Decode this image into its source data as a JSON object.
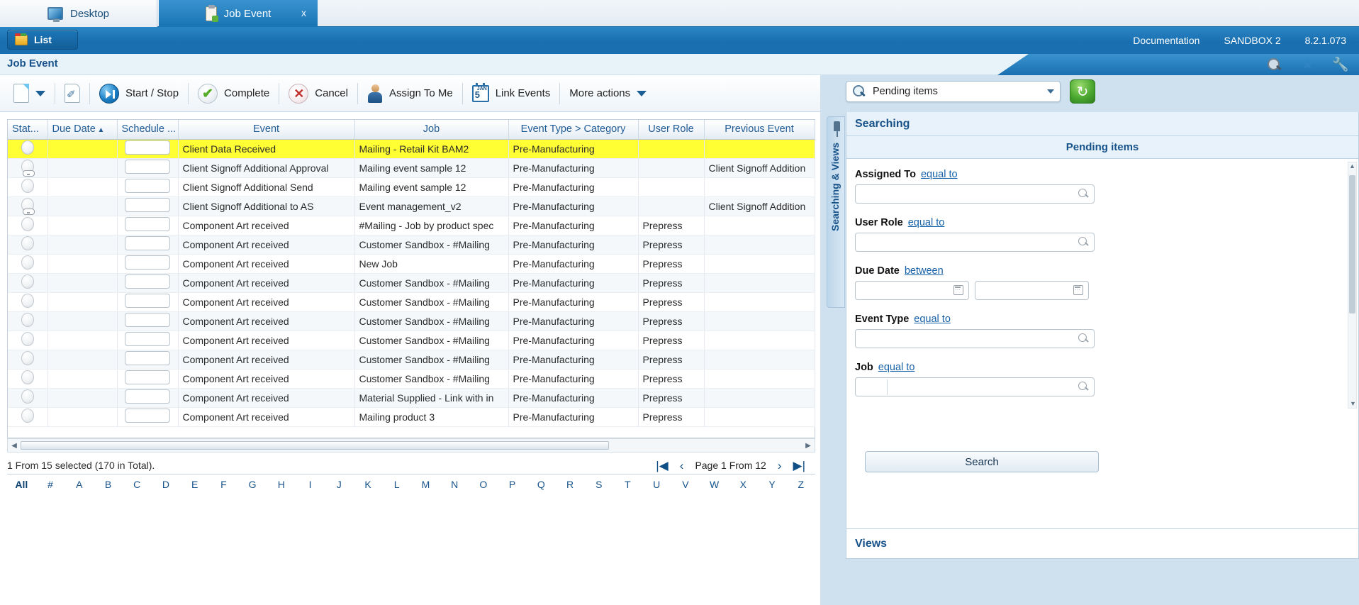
{
  "tabs": [
    {
      "label": "Desktop",
      "icon": "monitor-icon",
      "active": false
    },
    {
      "label": "Job Event",
      "icon": "clipboard-icon",
      "active": true,
      "close": "x"
    }
  ],
  "header": {
    "list_button": "List",
    "documentation": "Documentation",
    "environment": "SANDBOX 2",
    "version": "8.2.1.073"
  },
  "page": {
    "title": "Job Event"
  },
  "toolbar": {
    "new_label": "",
    "edit_label": "",
    "start_stop": "Start / Stop",
    "complete": "Complete",
    "cancel": "Cancel",
    "assign_to_me": "Assign To Me",
    "link_events": "Link Events",
    "more_actions": "More actions"
  },
  "grid": {
    "columns": [
      {
        "label": "Stat...",
        "sort": ""
      },
      {
        "label": "Due Date",
        "sort": "▲"
      },
      {
        "label": "Schedule ...",
        "sort": ""
      },
      {
        "label": "Event",
        "sort": ""
      },
      {
        "label": "Job",
        "sort": ""
      },
      {
        "label": "Event Type > Category",
        "sort": ""
      },
      {
        "label": "User Role",
        "sort": ""
      },
      {
        "label": "Previous Event",
        "sort": ""
      }
    ],
    "rows": [
      {
        "status": "pending",
        "due": "",
        "schedule": "",
        "event": "Client Data Received",
        "job": "Mailing - Retail Kit BAM2",
        "type": "Pre-Manufacturing",
        "role": "",
        "prev": "",
        "selected": true
      },
      {
        "status": "linked",
        "due": "",
        "schedule": "",
        "event": "Client Signoff Additional Approval",
        "job": "Mailing event sample 12",
        "type": "Pre-Manufacturing",
        "role": "",
        "prev": "Client Signoff Addition"
      },
      {
        "status": "pending",
        "due": "",
        "schedule": "",
        "event": "Client Signoff Additional Send",
        "job": "Mailing event sample 12",
        "type": "Pre-Manufacturing",
        "role": "",
        "prev": ""
      },
      {
        "status": "linked",
        "due": "",
        "schedule": "",
        "event": "Client Signoff Additional to AS",
        "job": "Event management_v2",
        "type": "Pre-Manufacturing",
        "role": "",
        "prev": "Client Signoff Addition"
      },
      {
        "status": "pending",
        "due": "",
        "schedule": "",
        "event": "Component Art received",
        "job": "#Mailing - Job by product spec",
        "type": "Pre-Manufacturing",
        "role": "Prepress",
        "prev": ""
      },
      {
        "status": "pending",
        "due": "",
        "schedule": "",
        "event": "Component Art received",
        "job": "Customer Sandbox - #Mailing",
        "type": "Pre-Manufacturing",
        "role": "Prepress",
        "prev": ""
      },
      {
        "status": "pending",
        "due": "",
        "schedule": "",
        "event": "Component Art received",
        "job": "New Job",
        "type": "Pre-Manufacturing",
        "role": "Prepress",
        "prev": ""
      },
      {
        "status": "pending",
        "due": "",
        "schedule": "",
        "event": "Component Art received",
        "job": "Customer Sandbox - #Mailing",
        "type": "Pre-Manufacturing",
        "role": "Prepress",
        "prev": ""
      },
      {
        "status": "pending",
        "due": "",
        "schedule": "",
        "event": "Component Art received",
        "job": "Customer Sandbox - #Mailing",
        "type": "Pre-Manufacturing",
        "role": "Prepress",
        "prev": ""
      },
      {
        "status": "pending",
        "due": "",
        "schedule": "",
        "event": "Component Art received",
        "job": "Customer Sandbox - #Mailing",
        "type": "Pre-Manufacturing",
        "role": "Prepress",
        "prev": ""
      },
      {
        "status": "pending",
        "due": "",
        "schedule": "",
        "event": "Component Art received",
        "job": "Customer Sandbox - #Mailing",
        "type": "Pre-Manufacturing",
        "role": "Prepress",
        "prev": ""
      },
      {
        "status": "pending",
        "due": "",
        "schedule": "",
        "event": "Component Art received",
        "job": "Customer Sandbox - #Mailing",
        "type": "Pre-Manufacturing",
        "role": "Prepress",
        "prev": ""
      },
      {
        "status": "pending",
        "due": "",
        "schedule": "",
        "event": "Component Art received",
        "job": "Customer Sandbox - #Mailing",
        "type": "Pre-Manufacturing",
        "role": "Prepress",
        "prev": ""
      },
      {
        "status": "pending",
        "due": "",
        "schedule": "",
        "event": "Component Art received",
        "job": "Material Supplied - Link with in",
        "type": "Pre-Manufacturing",
        "role": "Prepress",
        "prev": ""
      },
      {
        "status": "pending",
        "due": "",
        "schedule": "",
        "event": "Component Art received",
        "job": "Mailing product 3",
        "type": "Pre-Manufacturing",
        "role": "Prepress",
        "prev": ""
      }
    ]
  },
  "status": {
    "summary": "1 From 15 selected (170 in Total).",
    "page_text": "Page 1 From 12",
    "first": "|◀",
    "prev": "‹",
    "next": "›",
    "last": "▶|"
  },
  "alphabet": [
    "All",
    "#",
    "A",
    "B",
    "C",
    "D",
    "E",
    "F",
    "G",
    "H",
    "I",
    "J",
    "K",
    "L",
    "M",
    "N",
    "O",
    "P",
    "Q",
    "R",
    "S",
    "T",
    "U",
    "V",
    "W",
    "X",
    "Y",
    "Z"
  ],
  "sidebar": {
    "vertical_tab": "Searching & Views",
    "search_select": "Pending items",
    "panel_title": "Searching",
    "panel_subtitle": "Pending items",
    "fields": [
      {
        "label": "Assigned To",
        "operator": "equal to",
        "kind": "lookup",
        "value": ""
      },
      {
        "label": "User Role",
        "operator": "equal to",
        "kind": "lookup",
        "value": ""
      },
      {
        "label": "Due Date",
        "operator": "between",
        "kind": "daterange",
        "value": "",
        "value2": ""
      },
      {
        "label": "Event Type",
        "operator": "equal to",
        "kind": "lookup",
        "value": ""
      },
      {
        "label": "Job",
        "operator": "equal to",
        "kind": "lookup-split",
        "value": ""
      }
    ],
    "search_button": "Search",
    "views_label": "Views"
  },
  "colors": {
    "brand_blue": "#1a6fb0",
    "accent_link": "#1660a8",
    "selected_row": "#ffff33",
    "header_text": "#17538a"
  }
}
